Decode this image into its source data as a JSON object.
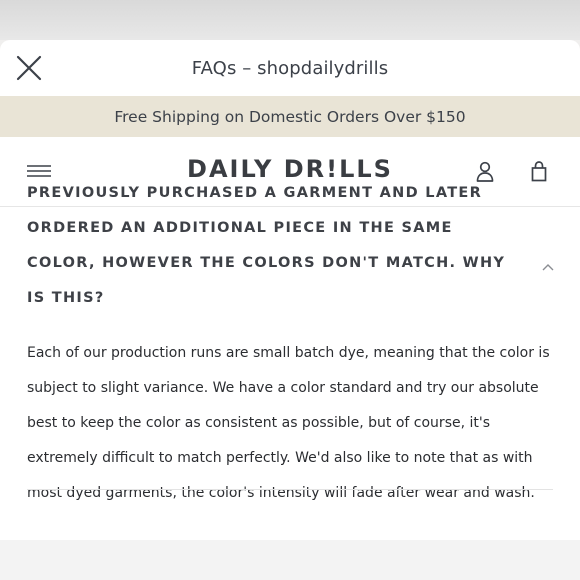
{
  "modal": {
    "title": "FAQs – shopdailydrills",
    "close_icon": "close-icon"
  },
  "banner": {
    "text": "Free Shipping on Domestic Orders Over $150"
  },
  "navbar": {
    "logo": "DAILY DR!LLS",
    "menu_icon": "hamburger-menu-icon",
    "account_icon": "user-icon",
    "cart_icon": "shopping-bag-icon"
  },
  "faq": {
    "question": "PREVIOUSLY PURCHASED A GARMENT AND LATER ORDERED AN ADDITIONAL PIECE IN THE SAME COLOR, HOWEVER THE COLORS DON'T MATCH. WHY IS THIS?",
    "answer": "Each of our production runs are small batch dye, meaning that the color is subject to slight variance. We have a color standard and try our absolute best to keep the color as consistent as possible, but of course, it's extremely difficult to match perfectly. We'd also like to note that as with most dyed garments, the color's intensity will fade after wear and wash.",
    "expanded": true,
    "toggle_icon": "chevron-up-icon"
  },
  "colors": {
    "banner_bg": "#e9e4d6",
    "text": "#3a3d42"
  }
}
